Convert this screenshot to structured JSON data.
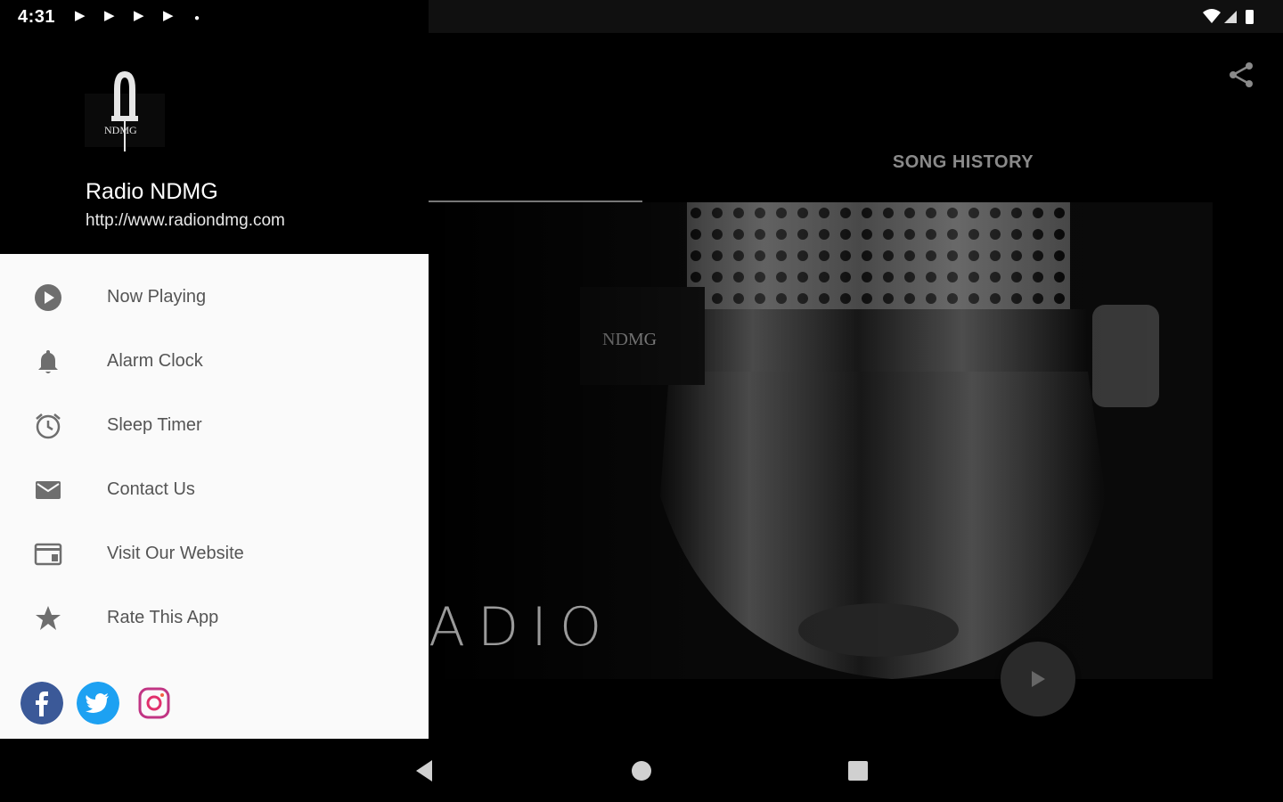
{
  "status_bar": {
    "time": "4:31"
  },
  "app": {
    "tabs": [
      {
        "label": ""
      },
      {
        "label": "SONG HISTORY"
      }
    ],
    "artwork_caption": "ADIO",
    "share_icon": "share-icon",
    "play_icon": "play-icon"
  },
  "drawer": {
    "station_name": "Radio NDMG",
    "station_url": "http://www.radiondmg.com",
    "logo_text": "NDMG",
    "menu": [
      {
        "label": "Now Playing",
        "icon": "play-circle-icon"
      },
      {
        "label": "Alarm Clock",
        "icon": "bell-icon"
      },
      {
        "label": "Sleep Timer",
        "icon": "alarm-clock-icon"
      },
      {
        "label": "Contact Us",
        "icon": "mail-icon"
      },
      {
        "label": "Visit Our Website",
        "icon": "browser-icon"
      },
      {
        "label": "Rate This App",
        "icon": "star-icon"
      }
    ],
    "social": [
      {
        "name": "facebook",
        "color": "#3b5998"
      },
      {
        "name": "twitter",
        "color": "#1da1f2"
      },
      {
        "name": "instagram",
        "color": "#c13584"
      }
    ]
  },
  "colors": {
    "drawer_body_bg": "#fafafa",
    "menu_text": "#555555",
    "accent_grey": "#777777"
  }
}
